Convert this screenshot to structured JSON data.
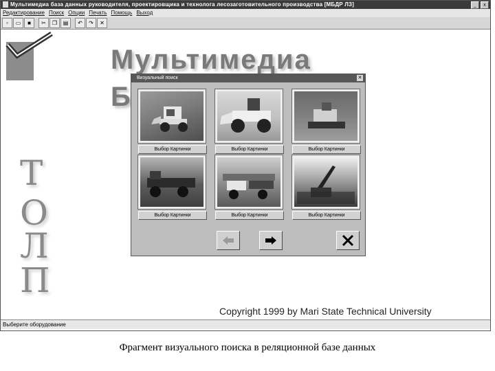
{
  "window": {
    "title": "Мультимедиа база данных руководителя, проектировщика и технолога лесозаготовительного производства [МБДР ЛЗ]"
  },
  "menu": [
    "Редактирование",
    "Поиск",
    "Опции",
    "Печать",
    "Помощь",
    "Выход"
  ],
  "background": {
    "title_line1": "Мультимедиа",
    "title_line2": "Б",
    "vertical_letters": [
      "Т",
      "О",
      "Л",
      "П"
    ],
    "copyright": "Copyright 1999 by Mari State Technical University"
  },
  "statusbar": {
    "text": "Выберите оборудование"
  },
  "dialog": {
    "title": "Визуальный поиск",
    "close_label": "✕",
    "pick_label": "Выбор Картинки",
    "items": [
      {
        "pick_label": "Выбор Картинки"
      },
      {
        "pick_label": "Выбор Картинки"
      },
      {
        "pick_label": "Выбор Картинки"
      },
      {
        "pick_label": "Выбор Картинки"
      },
      {
        "pick_label": "Выбор Картинки"
      },
      {
        "pick_label": "Выбор Картинки"
      }
    ],
    "nav": {
      "prev_icon": "arrow-left-icon",
      "next_icon": "arrow-right-icon",
      "close_icon": "close-icon"
    }
  },
  "caption": "Фрагмент визуального поиска в реляционной базе данных"
}
